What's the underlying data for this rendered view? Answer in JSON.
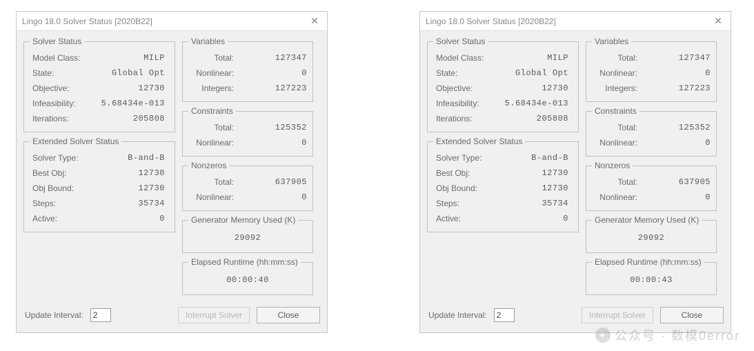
{
  "dialogs": [
    {
      "title": "Lingo 18.0 Solver Status [2020B22]",
      "solverStatus": {
        "legend": "Solver Status",
        "modelClassLabel": "Model Class:",
        "modelClass": "MILP",
        "stateLabel": "State:",
        "state": "Global Opt",
        "objectiveLabel": "Objective:",
        "objective": "12730",
        "infeasLabel": "Infeasibility:",
        "infeas": "5.68434e-013",
        "iterLabel": "Iterations:",
        "iter": "205808"
      },
      "extended": {
        "legend": "Extended Solver Status",
        "solverTypeLabel": "Solver Type:",
        "solverType": "B-and-B",
        "bestObjLabel": "Best Obj:",
        "bestObj": "12730",
        "objBoundLabel": "Obj Bound:",
        "objBound": "12730",
        "stepsLabel": "Steps:",
        "steps": "35734",
        "activeLabel": "Active:",
        "active": "0"
      },
      "variables": {
        "legend": "Variables",
        "totalLabel": "Total:",
        "total": "127347",
        "nonlinLabel": "Nonlinear:",
        "nonlin": "0",
        "intLabel": "Integers:",
        "int": "127223"
      },
      "constraints": {
        "legend": "Constraints",
        "totalLabel": "Total:",
        "total": "125352",
        "nonlinLabel": "Nonlinear:",
        "nonlin": "0"
      },
      "nonzeros": {
        "legend": "Nonzeros",
        "totalLabel": "Total:",
        "total": "637905",
        "nonlinLabel": "Nonlinear:",
        "nonlin": "0"
      },
      "genmem": {
        "legend": "Generator Memory Used (K)",
        "value": "29092"
      },
      "elapsed": {
        "legend": "Elapsed Runtime (hh:mm:ss)",
        "value": "00:00:40"
      },
      "footer": {
        "updateLabel": "Update Interval:",
        "updateValue": "2",
        "interrupt": "Interrupt Solver",
        "close": "Close"
      }
    },
    {
      "title": "Lingo 18.0 Solver Status [2020B22]",
      "solverStatus": {
        "legend": "Solver Status",
        "modelClassLabel": "Model Class:",
        "modelClass": "MILP",
        "stateLabel": "State:",
        "state": "Global Opt",
        "objectiveLabel": "Objective:",
        "objective": "12730",
        "infeasLabel": "Infeasibility:",
        "infeas": "5.68434e-013",
        "iterLabel": "Iterations:",
        "iter": "205808"
      },
      "extended": {
        "legend": "Extended Solver Status",
        "solverTypeLabel": "Solver Type:",
        "solverType": "B-and-B",
        "bestObjLabel": "Best Obj:",
        "bestObj": "12730",
        "objBoundLabel": "Obj Bound:",
        "objBound": "12730",
        "stepsLabel": "Steps:",
        "steps": "35734",
        "activeLabel": "Active:",
        "active": "0"
      },
      "variables": {
        "legend": "Variables",
        "totalLabel": "Total:",
        "total": "127347",
        "nonlinLabel": "Nonlinear:",
        "nonlin": "0",
        "intLabel": "Integers:",
        "int": "127223"
      },
      "constraints": {
        "legend": "Constraints",
        "totalLabel": "Total:",
        "total": "125352",
        "nonlinLabel": "Nonlinear:",
        "nonlin": "0"
      },
      "nonzeros": {
        "legend": "Nonzeros",
        "totalLabel": "Total:",
        "total": "637905",
        "nonlinLabel": "Nonlinear:",
        "nonlin": "0"
      },
      "genmem": {
        "legend": "Generator Memory Used (K)",
        "value": "29092"
      },
      "elapsed": {
        "legend": "Elapsed Runtime (hh:mm:ss)",
        "value": "00:00:43"
      },
      "footer": {
        "updateLabel": "Update Interval:",
        "updateValue": "2",
        "interrupt": "Interrupt Solver",
        "close": "Close"
      }
    }
  ],
  "watermark": {
    "text": "公众号 · 数模0error"
  }
}
